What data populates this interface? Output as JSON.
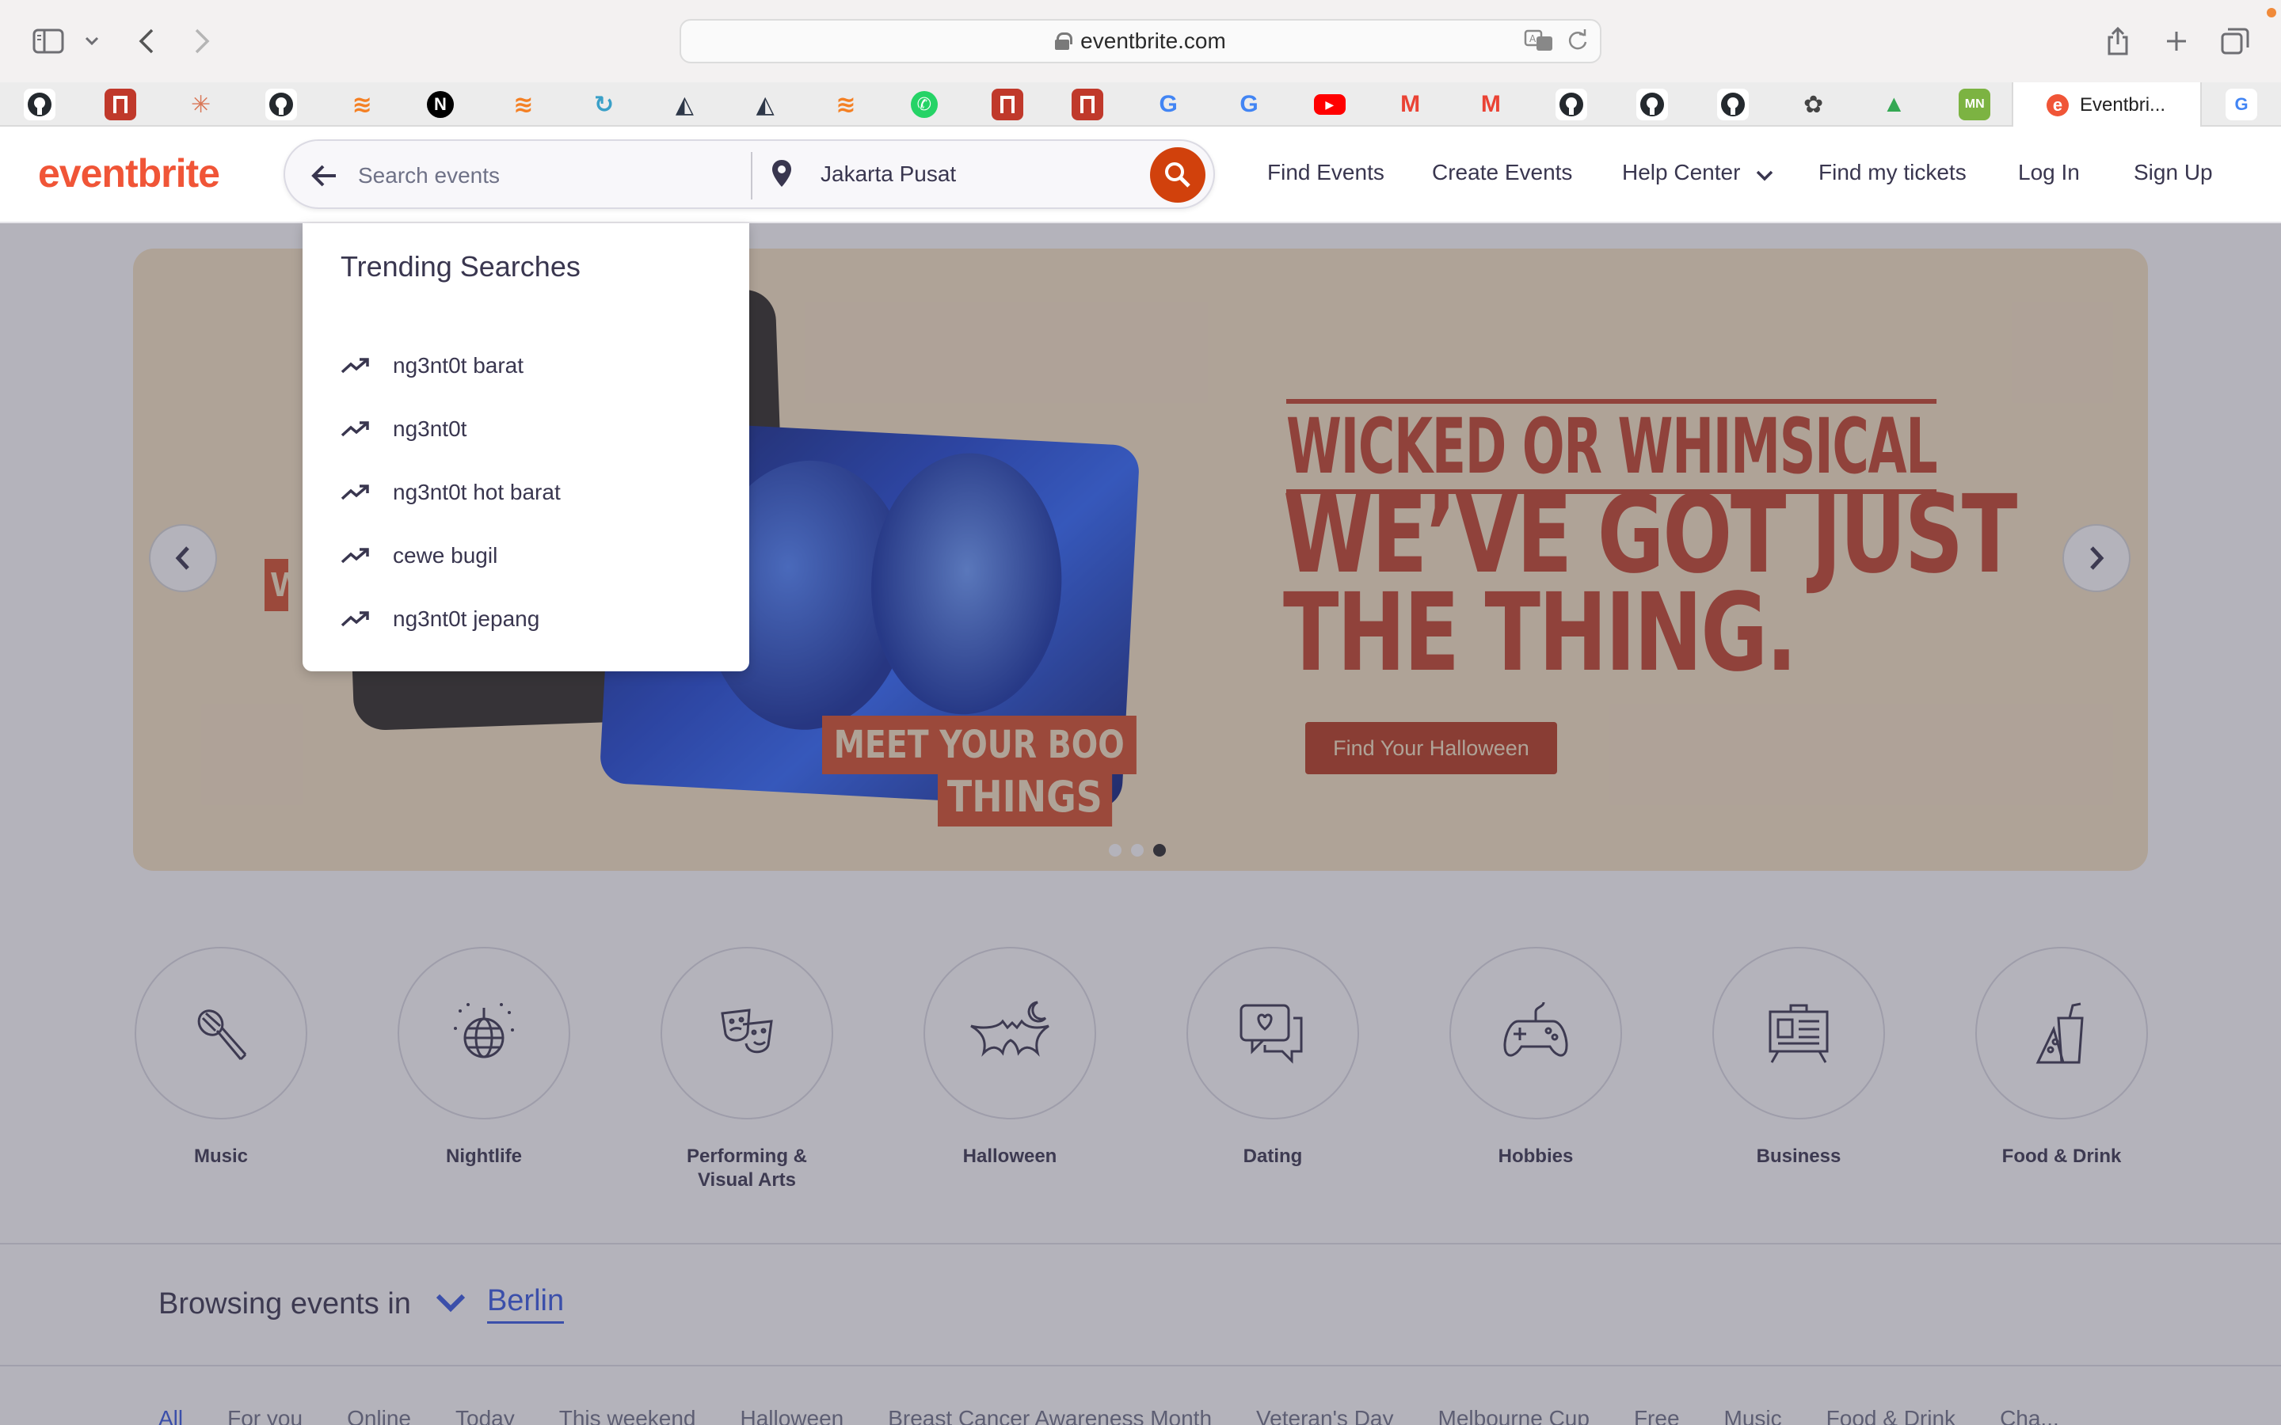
{
  "browser": {
    "url": "eventbrite.com",
    "active_tab_title": "Eventbri..."
  },
  "favorites": [
    {
      "name": "github-favicon",
      "glyph": "",
      "color": "#24292e"
    },
    {
      "name": "red-block-favicon",
      "glyph": "",
      "color": "#c0392b"
    },
    {
      "name": "claude-favicon",
      "glyph": "✳",
      "color": "#d97757"
    },
    {
      "name": "github-favicon",
      "glyph": "",
      "color": "#24292e"
    },
    {
      "name": "stackoverflow-favicon",
      "glyph": "≋",
      "color": "#f48024"
    },
    {
      "name": "nextjs-favicon",
      "glyph": "N",
      "color": "#000000"
    },
    {
      "name": "stackoverflow-favicon",
      "glyph": "≋",
      "color": "#f48024"
    },
    {
      "name": "refresh-favicon",
      "glyph": "↻",
      "color": "#3aa0c8"
    },
    {
      "name": "prisma-favicon",
      "glyph": "◭",
      "color": "#2d3748"
    },
    {
      "name": "prisma-favicon",
      "glyph": "◭",
      "color": "#2d3748"
    },
    {
      "name": "stackoverflow-favicon",
      "glyph": "≋",
      "color": "#f48024"
    },
    {
      "name": "whatsapp-favicon",
      "glyph": "✆",
      "color": "#25d366"
    },
    {
      "name": "red-block-favicon",
      "glyph": "",
      "color": "#c0392b"
    },
    {
      "name": "red-block-favicon",
      "glyph": "",
      "color": "#c0392b"
    },
    {
      "name": "google-favicon",
      "glyph": "G",
      "color": "#4285f4"
    },
    {
      "name": "google-favicon",
      "glyph": "G",
      "color": "#4285f4"
    },
    {
      "name": "youtube-favicon",
      "glyph": "▶",
      "color": "#ff0000"
    },
    {
      "name": "gmail-favicon",
      "glyph": "M",
      "color": "#ea4335"
    },
    {
      "name": "gmail-favicon",
      "glyph": "M",
      "color": "#ea4335"
    },
    {
      "name": "github-favicon",
      "glyph": "",
      "color": "#24292e"
    },
    {
      "name": "github-favicon",
      "glyph": "",
      "color": "#24292e"
    },
    {
      "name": "github-favicon",
      "glyph": "",
      "color": "#24292e"
    },
    {
      "name": "openai-favicon",
      "glyph": "✿",
      "color": "#444444"
    },
    {
      "name": "drive-favicon",
      "glyph": "▲",
      "color": "#34a853"
    },
    {
      "name": "mn-favicon",
      "glyph": "MN",
      "color": "#7cb342"
    }
  ],
  "header": {
    "logo": "eventbrite",
    "search_placeholder": "Search events",
    "location": "Jakarta Pusat",
    "nav": [
      "Find Events",
      "Create Events",
      "Help Center",
      "Find my tickets",
      "Log In",
      "Sign Up"
    ]
  },
  "dropdown": {
    "title": "Trending Searches",
    "items": [
      "ng3nt0t barat",
      "ng3nt0t",
      "ng3nt0t hot barat",
      "cewe bugil",
      "ng3nt0t jepang"
    ]
  },
  "hero": {
    "line1": "WICKED OR WHIMSICAL",
    "line2": "WE’VE GOT JUST",
    "line3": "THE THING.",
    "tag1": "MEET YOUR BOO",
    "tag2": "THINGS",
    "side_tag": "W",
    "cta": "Find Your Halloween",
    "active_slide": 3,
    "slide_count": 3
  },
  "categories": [
    {
      "label": "Music",
      "icon": "microphone-icon"
    },
    {
      "label": "Nightlife",
      "icon": "disco-ball-icon"
    },
    {
      "label": "Performing & Visual Arts",
      "icon": "theater-masks-icon"
    },
    {
      "label": "Halloween",
      "icon": "bat-moon-icon"
    },
    {
      "label": "Dating",
      "icon": "chat-heart-icon"
    },
    {
      "label": "Hobbies",
      "icon": "gamepad-icon"
    },
    {
      "label": "Business",
      "icon": "presentation-board-icon"
    },
    {
      "label": "Food & Drink",
      "icon": "food-drink-icon"
    }
  ],
  "browse": {
    "label": "Browsing events in",
    "city": "Berlin"
  },
  "filters": [
    "All",
    "For you",
    "Online",
    "Today",
    "This weekend",
    "Halloween",
    "Breast Cancer Awareness Month",
    "Veteran's Day",
    "Melbourne Cup",
    "Free",
    "Music",
    "Food & Drink",
    "Cha..."
  ],
  "colors": {
    "brand": "#f05537",
    "search_button": "#d1410c",
    "hero_bg": "#f7e4c4",
    "hero_text": "#c4442a",
    "link_blue": "#3659e3"
  }
}
